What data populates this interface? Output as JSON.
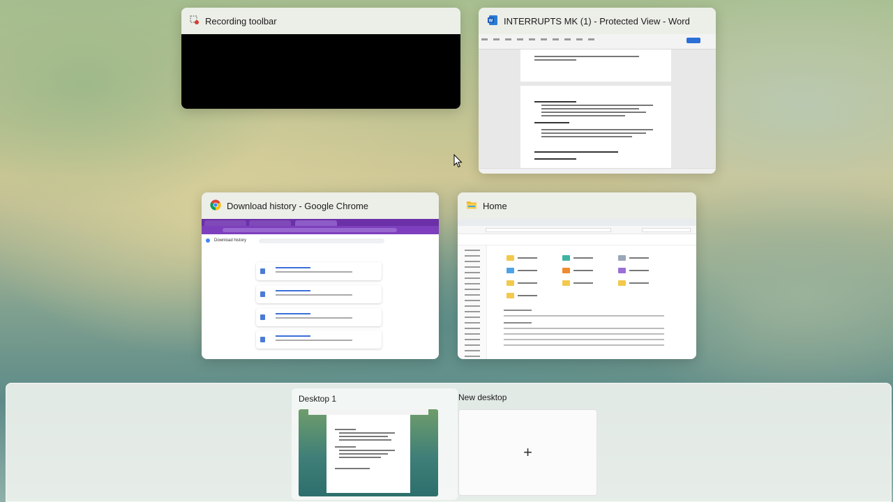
{
  "windows": {
    "recording": {
      "title": "Recording toolbar",
      "icon": "recording-toolbar-icon"
    },
    "word": {
      "title": "INTERRUPTS MK (1)  -  Protected View - Word",
      "icon": "word-icon",
      "icon_letter": "W",
      "accent": "#2b6fd6"
    },
    "chrome": {
      "title": "Download history - Google Chrome",
      "icon": "chrome-icon",
      "page_heading": "Download history",
      "accent": "#6b2fa8"
    },
    "explorer": {
      "title": "Home",
      "icon": "folder-icon"
    }
  },
  "taskview": {
    "desktop1_label": "Desktop 1",
    "new_desktop_label": "New desktop",
    "new_desktop_symbol": "+"
  }
}
